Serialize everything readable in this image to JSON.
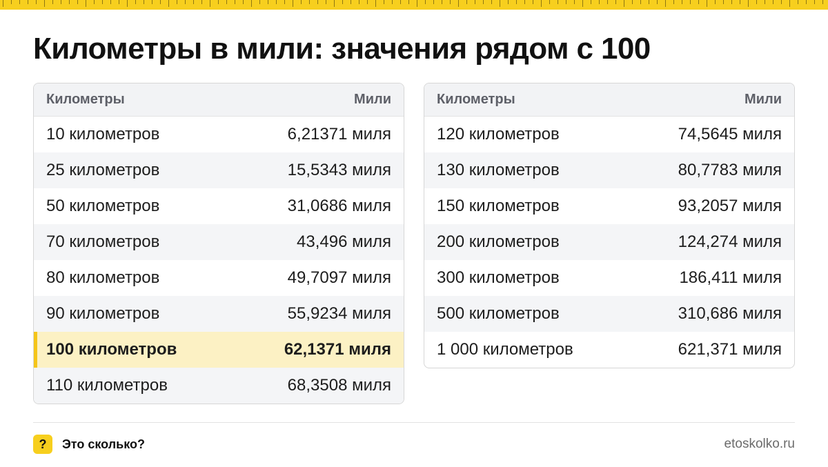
{
  "title": "Километры в мили: значения рядом с 100",
  "colors": {
    "accent": "#f7cf1e",
    "highlight_row": "#fcf1c4",
    "header_bg": "#f2f3f5"
  },
  "left_table": {
    "header": {
      "km": "Километры",
      "mi": "Мили"
    },
    "rows": [
      {
        "km": "10 километров",
        "mi": "6,21371 миля"
      },
      {
        "km": "25 километров",
        "mi": "15,5343 миля"
      },
      {
        "km": "50 километров",
        "mi": "31,0686 миля"
      },
      {
        "km": "70 километров",
        "mi": "43,496 миля"
      },
      {
        "km": "80 километров",
        "mi": "49,7097 миля"
      },
      {
        "km": "90 километров",
        "mi": "55,9234 миля"
      },
      {
        "km": "100 километров",
        "mi": "62,1371 миля"
      },
      {
        "km": "110 километров",
        "mi": "68,3508 миля"
      }
    ]
  },
  "right_table": {
    "header": {
      "km": "Километры",
      "mi": "Мили"
    },
    "rows": [
      {
        "km": "120 километров",
        "mi": "74,5645 миля"
      },
      {
        "km": "130 километров",
        "mi": "80,7783 миля"
      },
      {
        "km": "150 километров",
        "mi": "93,2057 миля"
      },
      {
        "km": "200 километров",
        "mi": "124,274 миля"
      },
      {
        "km": "300 километров",
        "mi": "186,411 миля"
      },
      {
        "km": "500 километров",
        "mi": "310,686 миля"
      },
      {
        "km": "1 000 километров",
        "mi": "621,371 миля"
      }
    ]
  },
  "footer": {
    "badge_icon": "question-mark-icon",
    "badge_glyph": "?",
    "brand": "Это сколько?",
    "site": "etoskolko.ru"
  }
}
